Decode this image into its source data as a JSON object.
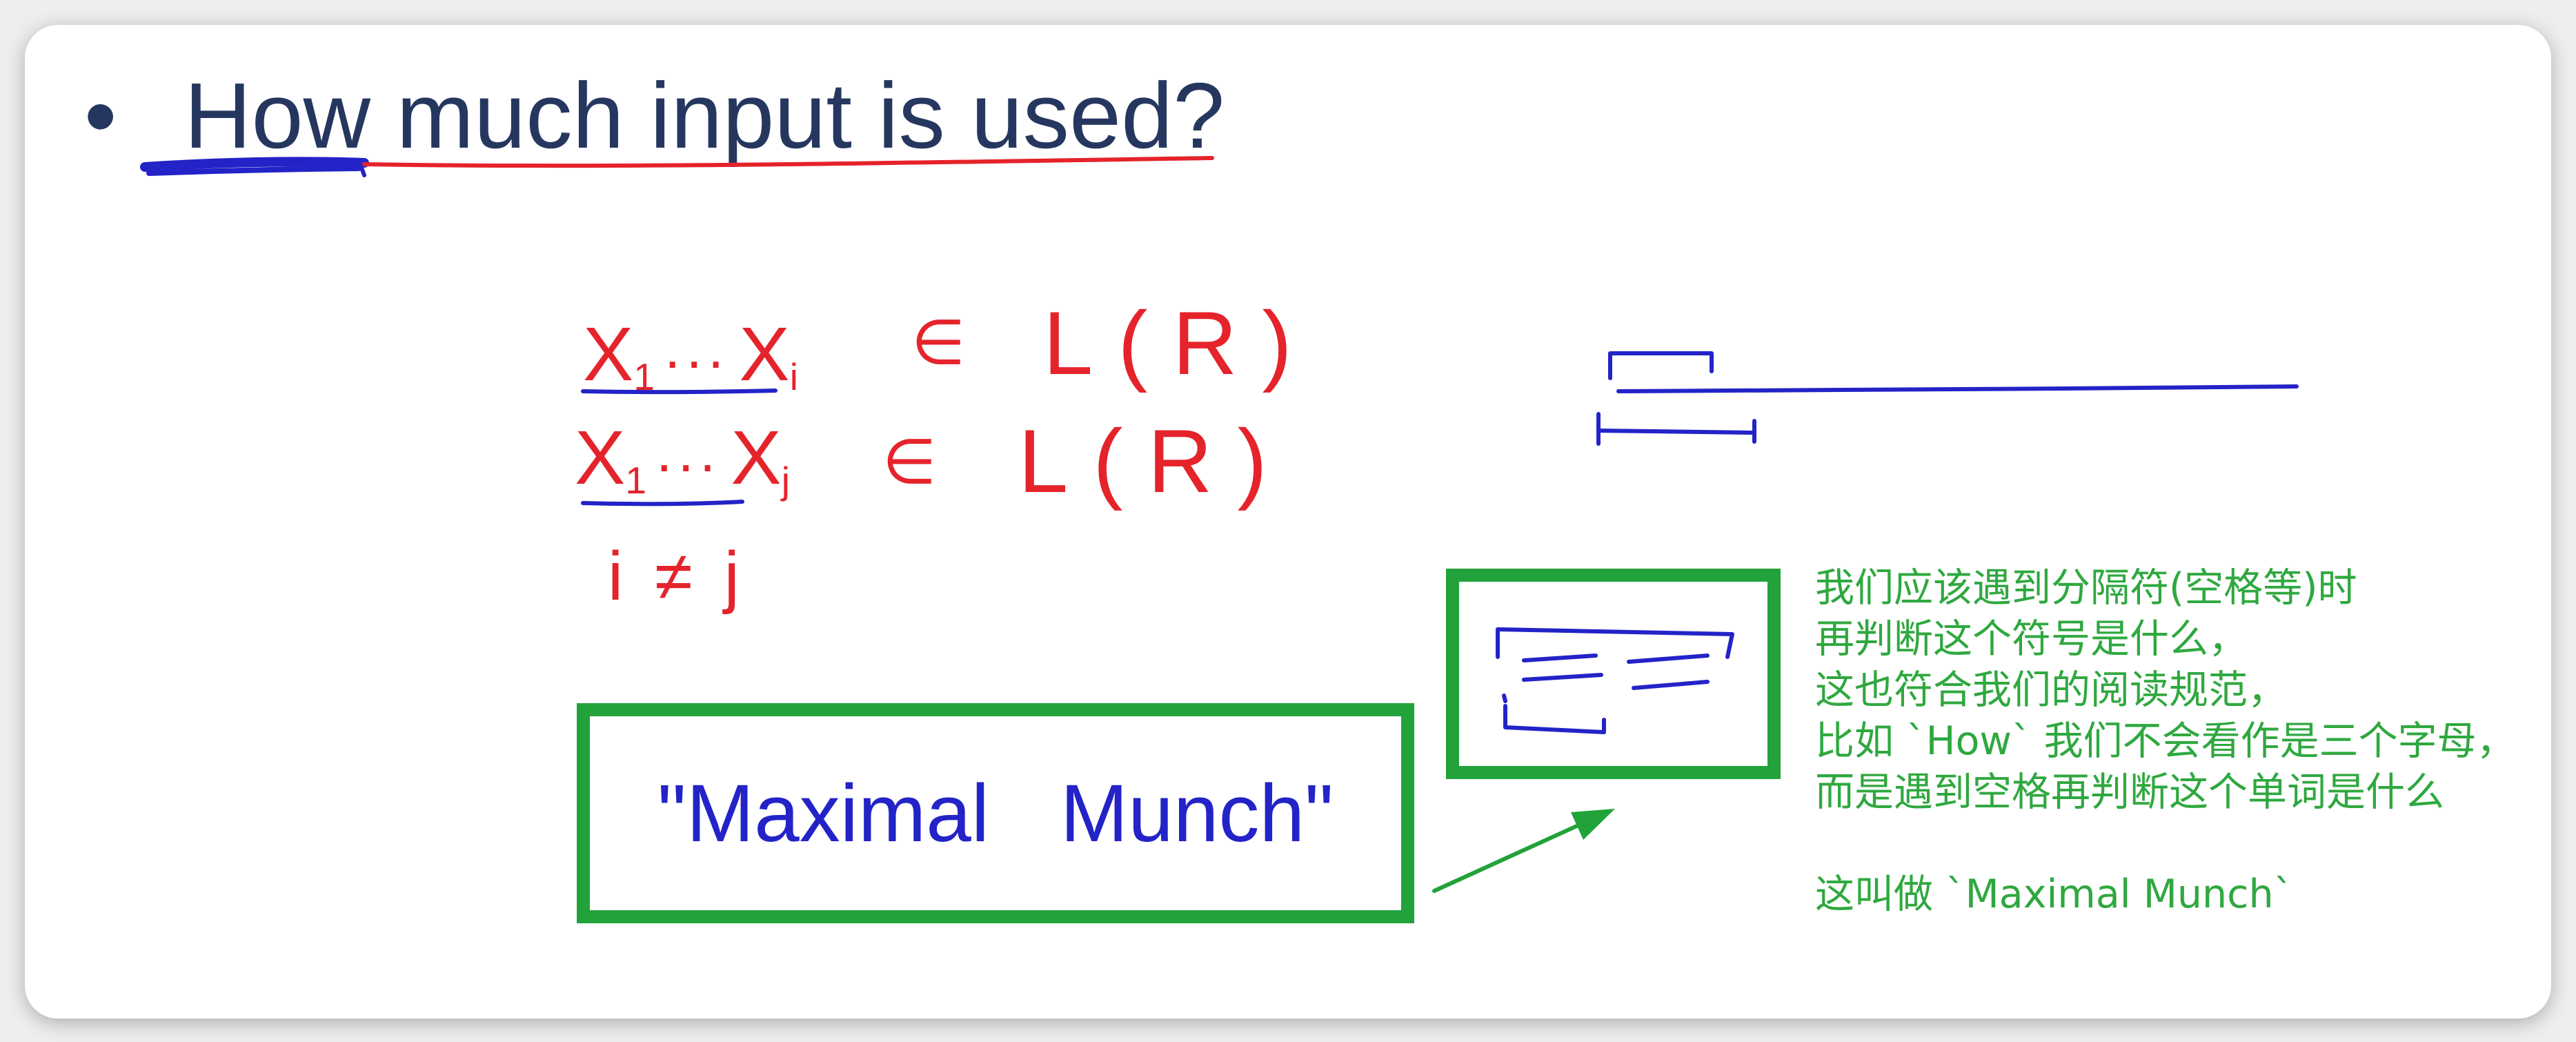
{
  "slide": {
    "bullet": "•",
    "title": "How much input is used?"
  },
  "formulas": [
    {
      "lhs": {
        "x1": "X",
        "s1": "1",
        "dots": "···",
        "x2": "X",
        "s2": "i"
      },
      "op": "∈",
      "rhs": "L(R)"
    },
    {
      "lhs": {
        "x1": "X",
        "s1": "1",
        "dots": "···",
        "x2": "X",
        "s2": "j"
      },
      "op": "∈",
      "rhs": "L(R)"
    }
  ],
  "condition": "i ≠ j",
  "highlight_box": {
    "label": "\"Maximal Munch\""
  },
  "note": {
    "lines": [
      "我们应该遇到分隔符(空格等)时",
      "再判断这个符号是什么，",
      "这也符合我们的阅读规范，",
      "比如 `How` 我们不会看作是三个字母，",
      "而是遇到空格再判断这个单词是什么"
    ],
    "closing": "这叫做 `Maximal Munch`"
  },
  "colors": {
    "title": "#26375f",
    "ink_red": "#e5232b",
    "ink_blue": "#2323c8",
    "box_green": "#22a23a",
    "note_green": "#2fa83f"
  }
}
